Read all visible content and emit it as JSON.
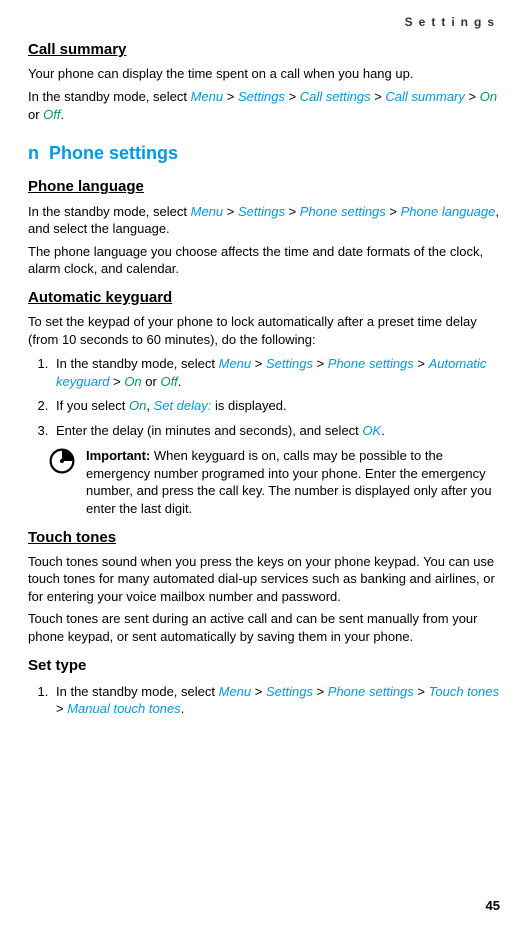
{
  "header": "Settings",
  "call_summary": {
    "title": "Call summary",
    "p1": "Your phone can display the time spent on a call when you hang up.",
    "p2a": "In the standby mode, select ",
    "menu": "Menu",
    "gt1": " > ",
    "settings": "Settings",
    "gt2": " > ",
    "callsettings": "Call settings",
    "gt3": " > ",
    "callsummary": "Call summary",
    "gt4": " > ",
    "on": "On",
    "ortxt": " or ",
    "off": "Off",
    "dot": "."
  },
  "chapter": {
    "prefix": "n",
    "title": "Phone settings"
  },
  "phone_lang": {
    "title": "Phone language",
    "a": "In the standby mode, select ",
    "menu": "Menu",
    "g1": " > ",
    "settings": "Settings",
    "g2": " > ",
    "ps": "Phone settings",
    "g3": " > ",
    "pl": "Phone language",
    "tail": ", and select the language.",
    "p2": "The phone language you choose affects the time and date formats of the clock, alarm clock, and calendar."
  },
  "keyguard": {
    "title": "Automatic keyguard",
    "intro": "To set the keypad of your phone to lock automatically after a preset time delay (from 10 seconds to 60 minutes), do the following:",
    "li1a": "In the standby mode, select ",
    "menu": "Menu",
    "g1": " > ",
    "settings": "Settings",
    "g2": " > ",
    "ps": "Phone settings",
    "g3": " > ",
    "ak": "Automatic keyguard",
    "g4": " > ",
    "on": "On",
    "or": " or ",
    "off": "Off",
    "dot": ".",
    "li2a": "If you select ",
    "li2on": "On",
    "li2b": ", ",
    "li2sd": "Set delay:",
    "li2c": " is displayed.",
    "li3a": "Enter the delay (in minutes and seconds), and select ",
    "li3ok": "OK",
    "li3dot": ".",
    "imp_label": "Important:",
    "imp_text": " When keyguard is on, calls may be possible to the emergency number programed into your phone. Enter the emergency number, and press the call key. The number is displayed only after you enter the last digit."
  },
  "touch": {
    "title": "Touch tones",
    "p1": "Touch tones sound when you press the keys on your phone keypad. You can use touch tones for many automated dial-up services such as banking and airlines, or for entering your voice mailbox number and password.",
    "p2": "Touch tones are sent during an active call and can be sent manually from your phone keypad, or sent automatically by saving them in your phone.",
    "subtitle": "Set type",
    "li1a": "In the standby mode, select ",
    "menu": "Menu",
    "g1": " > ",
    "settings": "Settings",
    "g2": " > ",
    "ps": "Phone settings",
    "g3": " > ",
    "tt": "Touch tones",
    "g4": " > ",
    "mtt": "Manual touch tones",
    "dot": "."
  },
  "pagenum": "45"
}
